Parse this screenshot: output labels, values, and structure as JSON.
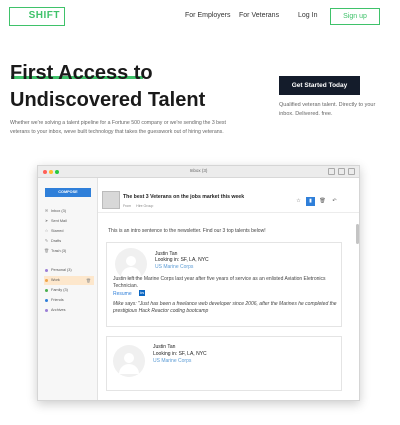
{
  "nav": {
    "logo": "SHIFT",
    "links": [
      "For Employers",
      "For Veterans",
      "Log In"
    ],
    "signup": "Sign up"
  },
  "hero": {
    "title_line1": "First Access to",
    "title_line2": "Undiscovered Talent",
    "subtitle": "Whether we're solving a talent pipeline for a Fortune 500 company or we're sending the 3 best veterans to your inbox, weve built technology that takes the guesswork out of hiring veterans.",
    "cta": "Get Started Today",
    "cta_sub": "Qualified veteran talent. Directly to your inbox. Delivered. free."
  },
  "colors": {
    "brand_green": "#3fc26a",
    "cta_dark": "#141c2b",
    "accent_blue": "#2f7fd9"
  },
  "app": {
    "window_title": "Inbox (3)",
    "compose": "COMPOSE",
    "folders": [
      {
        "label": "Inbox (3)",
        "icon": "inbox-icon"
      },
      {
        "label": "Sent Mail",
        "icon": "send-icon"
      },
      {
        "label": "Starred",
        "icon": "star-icon"
      },
      {
        "label": "Drafts",
        "icon": "draft-icon"
      },
      {
        "label": "Trash (3)",
        "icon": "trash-icon"
      }
    ],
    "labels": [
      {
        "label": "Personal (3)",
        "color": "#9b7fd6"
      },
      {
        "label": "Work",
        "color": "#f0a44a"
      },
      {
        "label": "Family (3)",
        "color": "#4caf50"
      },
      {
        "label": "Friends",
        "color": "#2f7fd9"
      },
      {
        "label": "Archives",
        "color": "#9b7fd6"
      }
    ],
    "message": {
      "subject": "The best 3 Veterans on the jobs market this week",
      "from_name": "From",
      "from_group": "Hire Group",
      "intro": "This is an intro sentence to the newsletter. Find our 3 top talents below!"
    },
    "candidates": [
      {
        "name": "Justin Tan",
        "location": "Looking in: SF, LA, NYC",
        "org": "US Marine Corps",
        "description": "Justin left the Marine Corps last year after five years of service as an enlisted Aviation Eletronics Technician.",
        "resume": "Resume",
        "quote": "Mike says: \"Just has been a freelance web developer since 2006, after the Marines he completed the prestigious Hack Reactor coding bootcamp"
      },
      {
        "name": "Justin Tan",
        "location": "Looking in: SF, LA, NYC",
        "org": "US Marine Corps"
      }
    ]
  }
}
